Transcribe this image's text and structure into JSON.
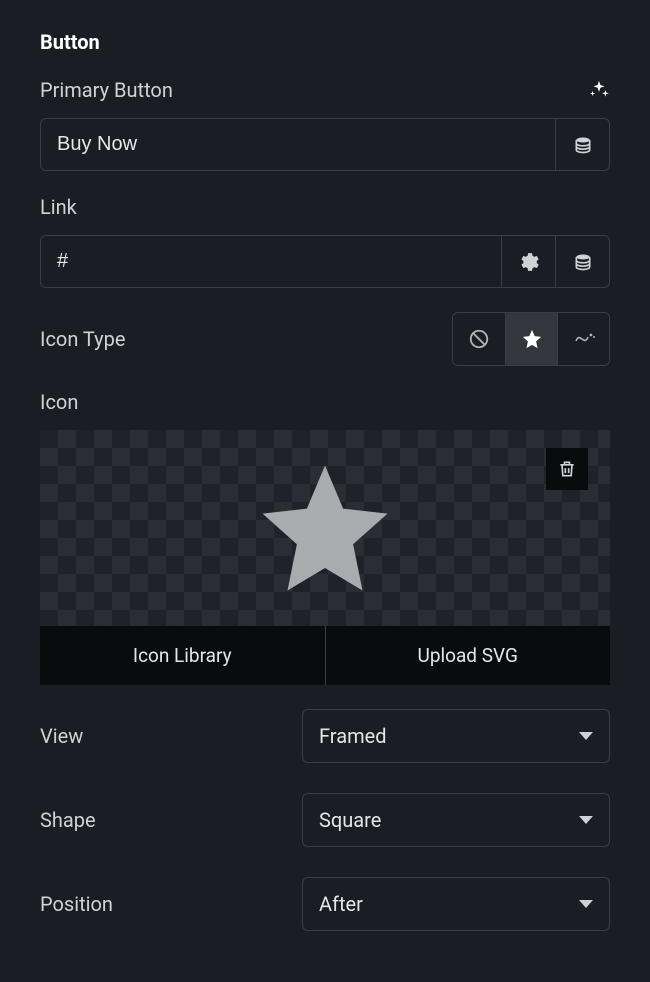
{
  "section": {
    "title": "Button"
  },
  "primary_button": {
    "label": "Primary Button",
    "value": "Buy Now"
  },
  "link": {
    "label": "Link",
    "value": "#"
  },
  "icon_type": {
    "label": "Icon Type",
    "options": [
      "none",
      "icon",
      "lottie"
    ],
    "selected": "icon"
  },
  "icon": {
    "label": "Icon",
    "library_label": "Icon Library",
    "upload_label": "Upload SVG"
  },
  "view": {
    "label": "View",
    "value": "Framed"
  },
  "shape": {
    "label": "Shape",
    "value": "Square"
  },
  "position": {
    "label": "Position",
    "value": "After"
  }
}
